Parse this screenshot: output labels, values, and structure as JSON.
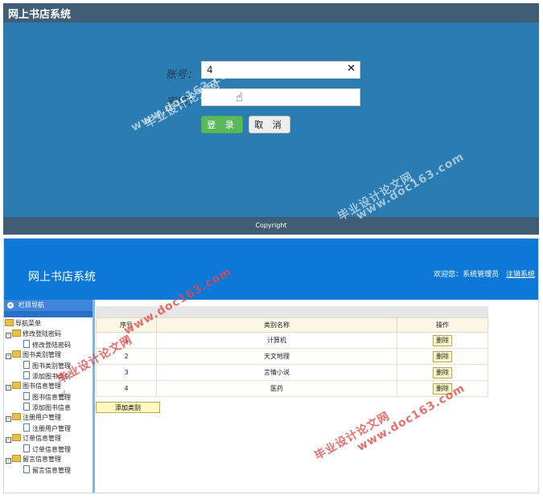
{
  "login": {
    "app_title": "网上书店系统",
    "account_label": "账号：",
    "password_label": "密码：",
    "account_value": "4",
    "password_value": "",
    "login_button": "登 录",
    "cancel_button": "取 消",
    "footer": "Copyright"
  },
  "admin": {
    "brand": "网上书店系统",
    "welcome": "欢迎您：系统管理员",
    "logout": "注销系统",
    "sidebar_header": "栏目导航",
    "nav_root": "导航菜单",
    "nav": [
      {
        "label": "修改登陆密码",
        "children": [
          "修改登陆密码"
        ]
      },
      {
        "label": "图书类别管理",
        "children": [
          "图书类别管理",
          "添加图书类别"
        ]
      },
      {
        "label": "图书信息管理",
        "children": [
          "图书信息管理",
          "添加图书信息"
        ]
      },
      {
        "label": "注册用户管理",
        "children": [
          "注册用户管理"
        ]
      },
      {
        "label": "订单信息管理",
        "children": [
          "订单信息管理"
        ]
      },
      {
        "label": "留言信息管理",
        "children": [
          "留言信息管理"
        ]
      }
    ],
    "table": {
      "columns": [
        "序号",
        "类别名称",
        "操作"
      ],
      "rows": [
        {
          "index": "1",
          "name": "计算机",
          "action": "删除"
        },
        {
          "index": "2",
          "name": "天文地理",
          "action": "删除"
        },
        {
          "index": "3",
          "name": "言情小说",
          "action": "删除"
        },
        {
          "index": "4",
          "name": "医药",
          "action": "删除"
        }
      ]
    },
    "add_button": "添加类别"
  },
  "watermarks": {
    "site": "www.doc163.com",
    "name": "毕业设计论文网"
  },
  "colors": {
    "login_bg": "#2b7cb0",
    "login_bar": "#405d74",
    "admin_header": "#0d78d8",
    "login_button": "#5cb85c",
    "watermark": "#e24a4a"
  }
}
